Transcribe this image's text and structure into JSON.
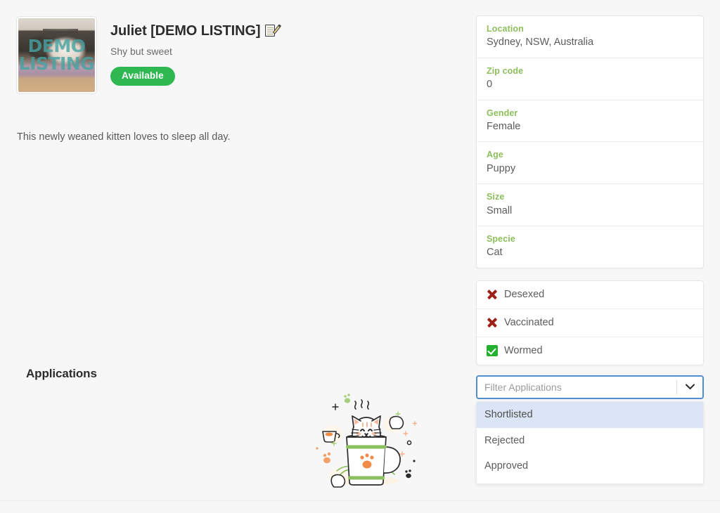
{
  "listing": {
    "title": "Juliet [DEMO LISTING]",
    "edit_icon": "memo-edit-icon",
    "subtitle": "Shy but sweet",
    "status_badge": "Available",
    "status_badge_color": "#2fb851",
    "description": "This newly weaned kitten loves to sleep all day.",
    "photo": {
      "alt": "Tabby kitten lying down",
      "watermark_line1": "DEMO",
      "watermark_line2": "LISTING",
      "watermark_color": "#48a8a8"
    }
  },
  "details": {
    "label_color": "#8dbe5c",
    "rows": [
      {
        "label": "Location",
        "value": "Sydney, NSW, Australia"
      },
      {
        "label": "Zip code",
        "value": "0"
      },
      {
        "label": "Gender",
        "value": "Female"
      },
      {
        "label": "Age",
        "value": "Puppy"
      },
      {
        "label": "Size",
        "value": "Small"
      },
      {
        "label": "Specie",
        "value": "Cat"
      }
    ]
  },
  "health": {
    "rows": [
      {
        "label": "Desexed",
        "state": "no",
        "icon": "cross-mark-icon"
      },
      {
        "label": "Vaccinated",
        "state": "no",
        "icon": "cross-mark-icon"
      },
      {
        "label": "Wormed",
        "state": "yes",
        "icon": "check-mark-box-icon"
      }
    ],
    "no_color": "#9e1f16",
    "yes_color": "#22b02e"
  },
  "applications": {
    "heading": "Applications",
    "filter": {
      "placeholder": "Filter Applications",
      "value": "",
      "focus_border_color": "#4f8fd1",
      "expanded": true,
      "options": [
        {
          "label": "Shortlisted",
          "selected": true
        },
        {
          "label": "Rejected",
          "selected": false
        },
        {
          "label": "Approved",
          "selected": false
        }
      ],
      "highlight_color": "#dbe5f5"
    },
    "empty_illustration": "cat-in-mug-illustration"
  }
}
